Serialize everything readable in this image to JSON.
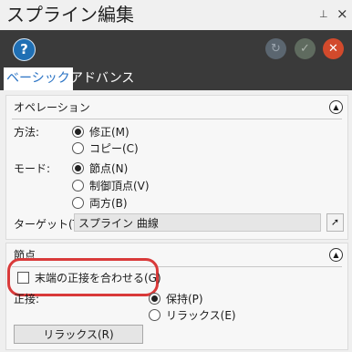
{
  "title": "スプライン編集",
  "titlebar": {
    "pin_icon": "pin-icon",
    "close_icon": "close-icon"
  },
  "toolbar": {
    "help_label": "?",
    "apply_icon": "apply-icon",
    "ok_icon": "check-icon",
    "cancel_icon": "cancel-icon",
    "colors": {
      "help": "#1f6fb4",
      "cancel": "#d24a2c"
    }
  },
  "tabs": [
    {
      "label": "ベーシック",
      "active": true
    },
    {
      "label": "アドバンス",
      "active": false
    }
  ],
  "operation_group": {
    "heading": "オペレーション",
    "method_label": "方法:",
    "method_options": [
      {
        "label": "修正(M)",
        "selected": true
      },
      {
        "label": "コピー(C)",
        "selected": false
      }
    ],
    "mode_label": "モード:",
    "mode_options": [
      {
        "label": "節点(N)",
        "selected": true
      },
      {
        "label": "制御頂点(V)",
        "selected": false
      },
      {
        "label": "両方(B)",
        "selected": false
      }
    ],
    "target_label": "ターゲット(T):",
    "target_value": "スプライン 曲線",
    "target_button_icon": "pointer-icon"
  },
  "knot_group": {
    "heading": "節点",
    "match_tangent_label": "末端の正接を合わせる(G)",
    "match_tangent_checked": false,
    "tangent_label": "正接:",
    "tangent_options": [
      {
        "label": "保持(P)",
        "selected": true
      },
      {
        "label": "リラックス(E)",
        "selected": false
      }
    ],
    "relax_button": "リラックス(R)",
    "highlight_color": "#d93a3a"
  }
}
